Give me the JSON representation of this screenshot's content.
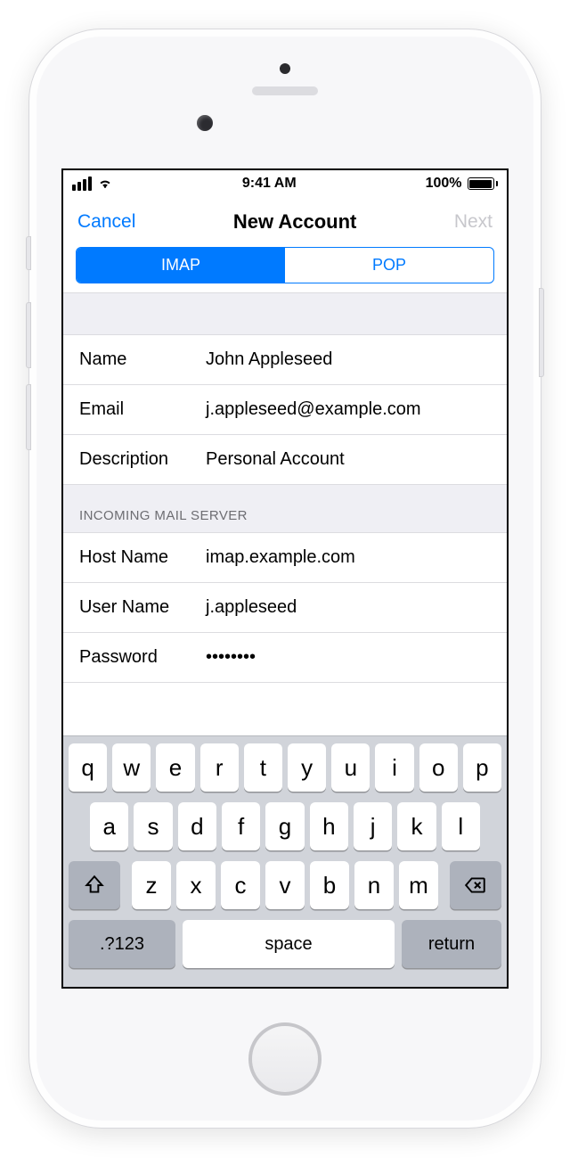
{
  "status": {
    "time": "9:41 AM",
    "battery_pct": "100%"
  },
  "nav": {
    "cancel": "Cancel",
    "title": "New Account",
    "next": "Next"
  },
  "segmented": {
    "imap": "IMAP",
    "pop": "POP",
    "active": "imap"
  },
  "account": {
    "name_label": "Name",
    "name_value": "John Appleseed",
    "email_label": "Email",
    "email_value": "j.appleseed@example.com",
    "description_label": "Description",
    "description_value": "Personal Account"
  },
  "incoming": {
    "header": "INCOMING MAIL SERVER",
    "host_label": "Host Name",
    "host_value": "imap.example.com",
    "user_label": "User Name",
    "user_value": "j.appleseed",
    "password_label": "Password",
    "password_value": "••••••••"
  },
  "keyboard": {
    "row1": [
      "q",
      "w",
      "e",
      "r",
      "t",
      "y",
      "u",
      "i",
      "o",
      "p"
    ],
    "row2": [
      "a",
      "s",
      "d",
      "f",
      "g",
      "h",
      "j",
      "k",
      "l"
    ],
    "row3": [
      "z",
      "x",
      "c",
      "v",
      "b",
      "n",
      "m"
    ],
    "mode_key": ".?123",
    "space_key": "space",
    "return_key": "return"
  }
}
